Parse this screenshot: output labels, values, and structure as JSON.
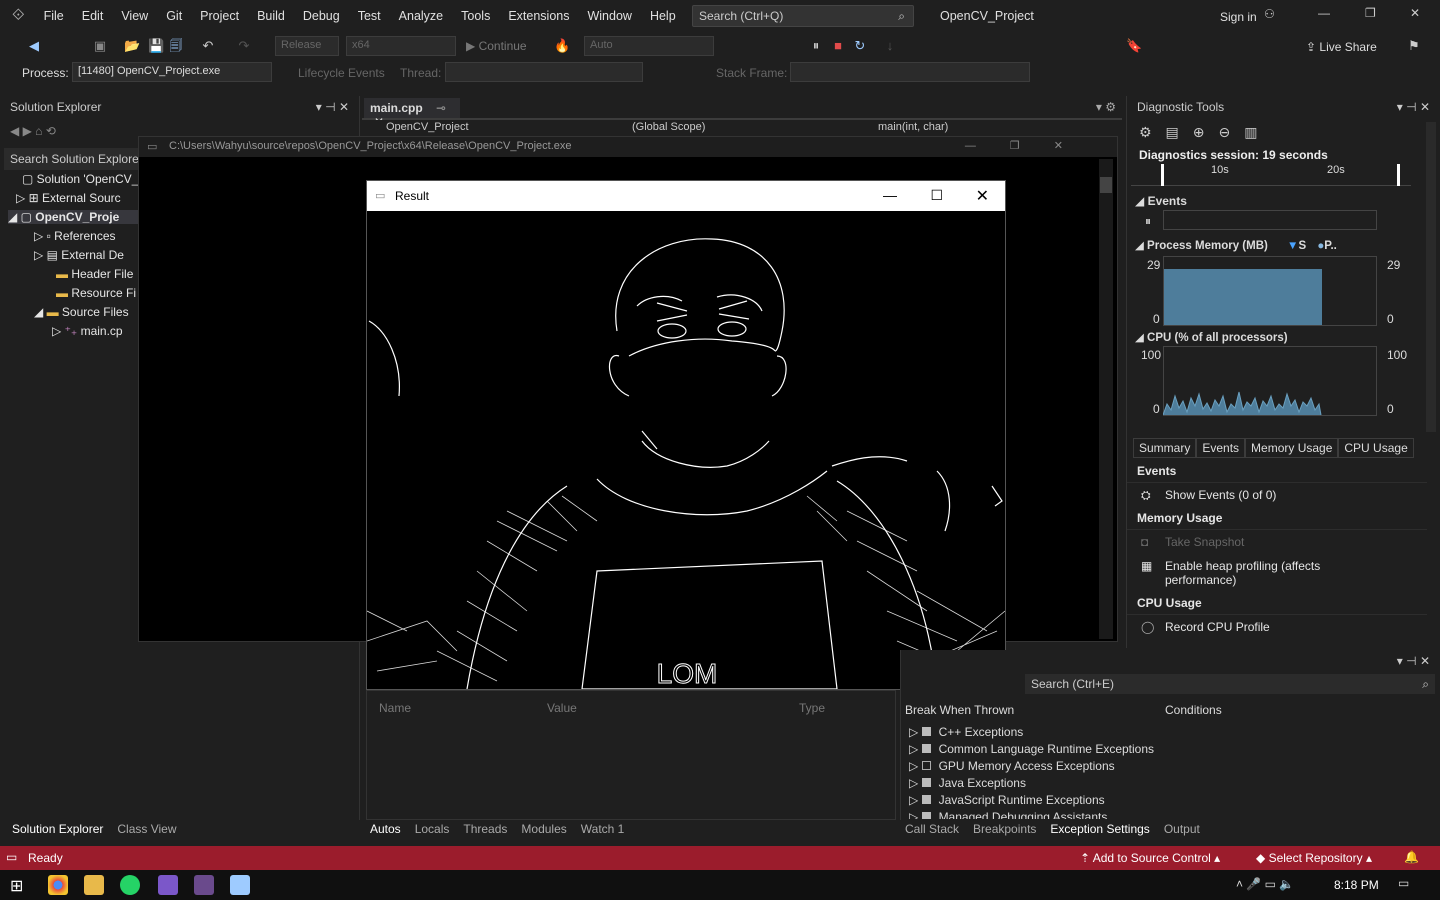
{
  "menu": {
    "items": [
      "File",
      "Edit",
      "View",
      "Git",
      "Project",
      "Build",
      "Debug",
      "Test",
      "Analyze",
      "Tools",
      "Extensions",
      "Window",
      "Help"
    ],
    "search_placeholder": "Search (Ctrl+Q)",
    "solution_name": "OpenCV_Project",
    "sign_in": "Sign in"
  },
  "toolbar": {
    "config": "Release",
    "platform": "x64",
    "continue": "Continue",
    "auto": "Auto",
    "live_share": "Live Share"
  },
  "toolbar2": {
    "process_label": "Process:",
    "process_value": "[11480] OpenCV_Project.exe",
    "lifecycle": "Lifecycle Events",
    "thread": "Thread:",
    "stack_frame": "Stack Frame:"
  },
  "solution_explorer": {
    "title": "Solution Explorer",
    "search": "Search Solution Explore",
    "items": [
      "Solution 'OpenCV_",
      "External Sourc",
      "OpenCV_Proje",
      "References",
      "External De",
      "Header File",
      "Resource Fi",
      "Source Files",
      "main.cp"
    ],
    "bottom_tabs": [
      "Solution Explorer",
      "Class View"
    ]
  },
  "editor": {
    "tab": "main.cpp",
    "nav1": "OpenCV_Project",
    "nav2": "(Global Scope)",
    "nav3": "main(int, char)"
  },
  "console": {
    "path": "C:\\Users\\Wahyu\\source\\repos\\OpenCV_Project\\x64\\Release\\OpenCV_Project.exe"
  },
  "result_window": {
    "title": "Result",
    "shirt_text": "LOM"
  },
  "diagnostic": {
    "title": "Diagnostic Tools",
    "session": "Diagnostics session: 19 seconds",
    "t1": "10s",
    "t2": "20s",
    "events": "Events",
    "memory": "Process Memory (MB)",
    "legend_s": "S",
    "legend_p": "P..",
    "mem_max": "29",
    "mem_min": "0",
    "cpu": "CPU (% of all processors)",
    "cpu_max": "100",
    "cpu_min": "0",
    "tabs": [
      "Summary",
      "Events",
      "Memory Usage",
      "CPU Usage"
    ],
    "sec_events": "Events",
    "show_events": "Show Events (0 of 0)",
    "sec_memory": "Memory Usage",
    "take_snapshot": "Take Snapshot",
    "heap": "Enable heap profiling (affects performance)",
    "sec_cpu": "CPU Usage",
    "record_cpu": "Record CPU Profile"
  },
  "autos": {
    "columns": [
      "Name",
      "Value",
      "Type"
    ],
    "tabs": [
      "Autos",
      "Locals",
      "Threads",
      "Modules",
      "Watch 1"
    ]
  },
  "exceptions": {
    "search": "Search (Ctrl+E)",
    "col1": "Break When Thrown",
    "col2": "Conditions",
    "items": [
      "C++ Exceptions",
      "Common Language Runtime Exceptions",
      "GPU Memory Access Exceptions",
      "Java Exceptions",
      "JavaScript Runtime Exceptions",
      "Managed Debugging Assistants"
    ],
    "tabs": [
      "Call Stack",
      "Breakpoints",
      "Exception Settings",
      "Output"
    ]
  },
  "status": {
    "ready": "Ready",
    "add_source": "Add to Source Control",
    "select_repo": "Select Repository"
  },
  "taskbar": {
    "time": "8:18 PM"
  }
}
